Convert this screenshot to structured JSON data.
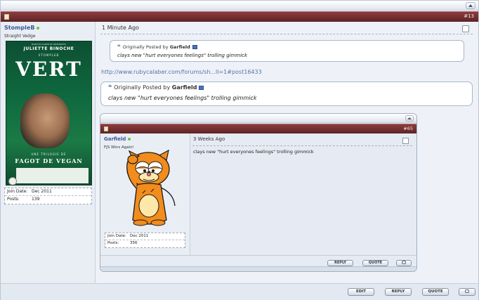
{
  "post": {
    "number": "#13",
    "timestamp": "1 Minute Ago",
    "user": {
      "name": "StompleB",
      "title": "Straight Vedge",
      "avatar": {
        "top_line": "MARTIN KARMITZ PRESENTE",
        "actor": "JULIETTE BINOCHE",
        "subtitle": "STOMPLEB",
        "title": "VERT",
        "bottom_line": "UNE TRILOGIE DE",
        "bottom_title": "FAGOT DE VEGAN"
      },
      "stats": [
        {
          "label": "Join Date:",
          "value": "Dec 2011"
        },
        {
          "label": "Posts:",
          "value": "139"
        }
      ]
    },
    "quote1": {
      "prefix": "Originally Posted by",
      "author": "Garfield",
      "text": "clays new \"hurt everyones feelings\" trolling gimmick"
    },
    "link": "http://www.rubycalaber.com/forums/sh...ll=1#post16433",
    "quote2": {
      "prefix": "Originally Posted by",
      "author": "Garfield",
      "text": "clays new \"hurt everyones feelings\" trolling gimmick"
    },
    "nested": {
      "number": "#65",
      "timestamp": "3 Weeks Ago",
      "user": {
        "name": "Garfield",
        "title": "FJS Wins Again!",
        "stats": [
          {
            "label": "Join Date:",
            "value": "Dec 2011"
          },
          {
            "label": "Posts:",
            "value": "356"
          }
        ]
      },
      "message": "clays new \"hurt everyones feelings\" trolling gimmick",
      "buttons": {
        "reply": "REPLY",
        "quote": "QUOTE"
      }
    },
    "footer": {
      "edit": "EDIT",
      "reply": "REPLY",
      "quote": "QUOTE"
    }
  }
}
